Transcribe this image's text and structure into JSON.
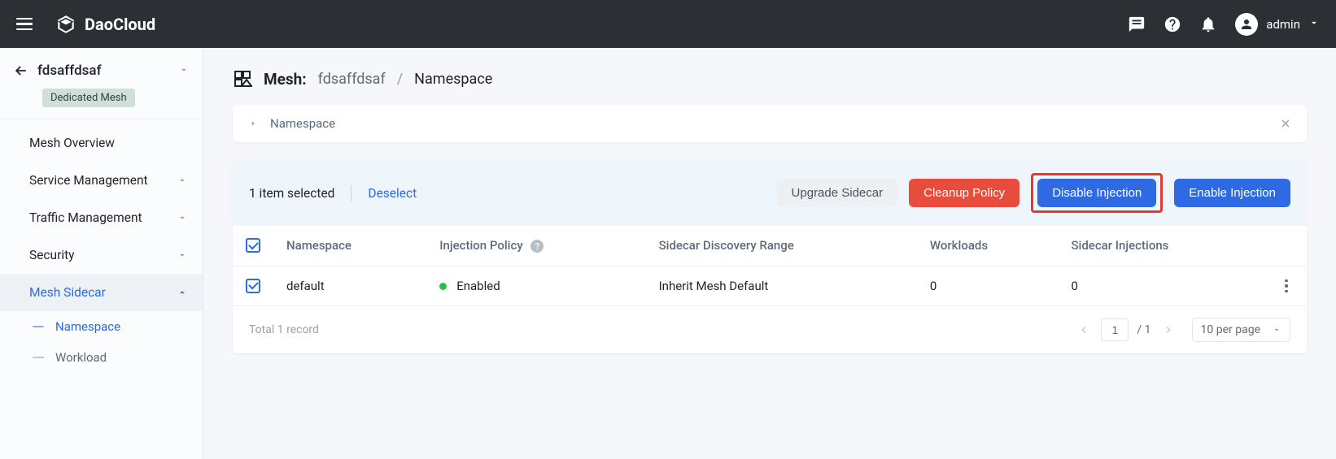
{
  "header": {
    "brand": "DaoCloud",
    "user": "admin"
  },
  "sidebar": {
    "mesh_name": "fdsaffdsaf",
    "mesh_badge": "Dedicated Mesh",
    "items": [
      {
        "label": "Mesh Overview",
        "expandable": false
      },
      {
        "label": "Service Management",
        "expandable": true
      },
      {
        "label": "Traffic Management",
        "expandable": true
      },
      {
        "label": "Security",
        "expandable": true
      },
      {
        "label": "Mesh Sidecar",
        "expandable": true,
        "active": true
      }
    ],
    "sub_items": [
      {
        "label": "Namespace",
        "active": true
      },
      {
        "label": "Workload",
        "active": false
      }
    ]
  },
  "breadcrumb": {
    "root_label": "Mesh:",
    "mesh_name": "fdsaffdsaf",
    "current": "Namespace"
  },
  "panel": {
    "title": "Namespace"
  },
  "toolbar": {
    "selection_text": "1 item selected",
    "deselect": "Deselect",
    "upgrade": "Upgrade Sidecar",
    "cleanup": "Cleanup Policy",
    "disable": "Disable Injection",
    "enable": "Enable Injection"
  },
  "table": {
    "columns": {
      "namespace": "Namespace",
      "injection_policy": "Injection Policy",
      "discovery_range": "Sidecar Discovery Range",
      "workloads": "Workloads",
      "sidecar_injections": "Sidecar Injections"
    },
    "rows": [
      {
        "namespace": "default",
        "injection_policy": "Enabled",
        "discovery_range": "Inherit Mesh Default",
        "workloads": "0",
        "sidecar_injections": "0"
      }
    ]
  },
  "footer": {
    "total_text": "Total 1 record",
    "page_current": "1",
    "page_total": "/ 1",
    "page_size": "10 per page"
  }
}
